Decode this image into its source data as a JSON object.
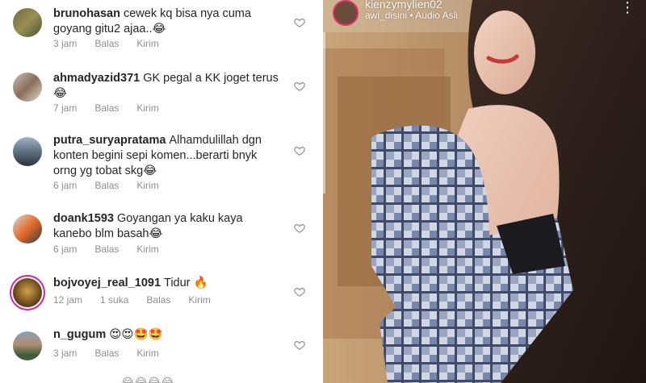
{
  "comments": [
    {
      "username": "brunohasan",
      "text": "cewek kq bisa nya cuma goyang gitu2 ajaa..😂",
      "time": "3 jam",
      "likes": "",
      "reply": "Balas",
      "send": "Kirim"
    },
    {
      "username": "ahmadyazid371",
      "text": "GK pegal a KK joget terus 😂",
      "time": "7 jam",
      "likes": "",
      "reply": "Balas",
      "send": "Kirim"
    },
    {
      "username": "putra_suryapratama",
      "text": "Alhamdulillah dgn konten begini sepi komen...berarti bnyk orng yg tobat skg😂",
      "time": "6 jam",
      "likes": "",
      "reply": "Balas",
      "send": "Kirim"
    },
    {
      "username": "doank1593",
      "text": "Goyangan ya kaku kaya kanebo blm basah😂",
      "time": "6 jam",
      "likes": "",
      "reply": "Balas",
      "send": "Kirim"
    },
    {
      "username": "bojvoyej_real_1091",
      "text": "Tidur 🔥",
      "time": "12 jam",
      "likes": "1 suka",
      "reply": "Balas",
      "send": "Kirim"
    },
    {
      "username": "n_gugum",
      "text": "😍😍🤩🤩",
      "time": "3 jam",
      "likes": "",
      "reply": "Balas",
      "send": "Kirim"
    }
  ],
  "more_emojis": "😂😂😂😂",
  "story": {
    "username": "kienzymylien02",
    "subtitle": "awi_disini • Audio Asli",
    "more_icon": "⋮"
  },
  "colors": {
    "text": "#262626",
    "meta": "#8e8e8e",
    "story_ring": "#e1306c"
  }
}
